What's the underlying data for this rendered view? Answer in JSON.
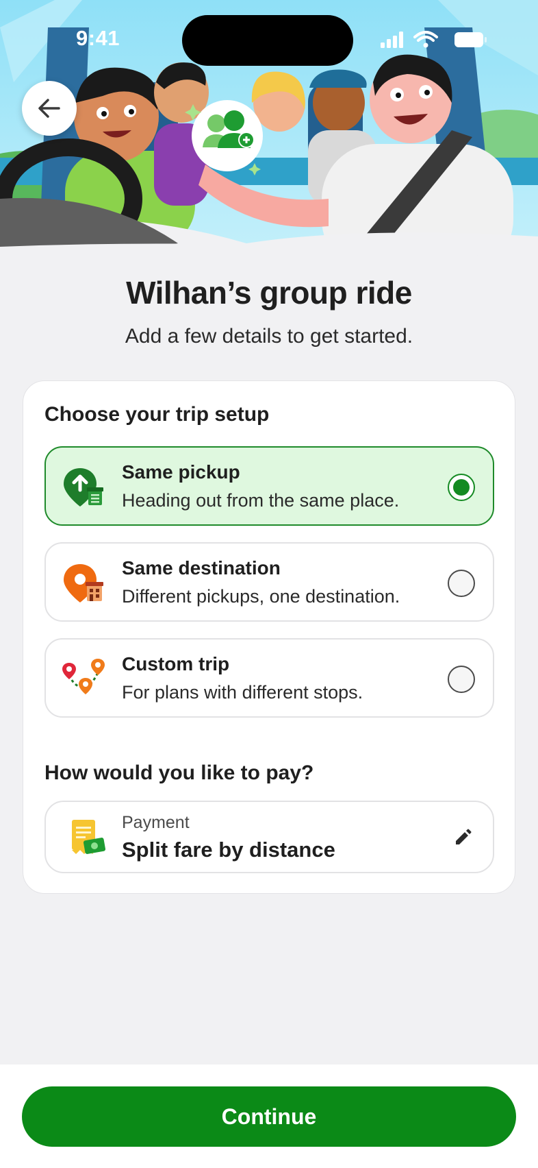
{
  "status_bar": {
    "time": "9:41"
  },
  "header": {
    "title": "Wilhan’s group ride",
    "subtitle": "Add a few details to get started."
  },
  "trip_setup": {
    "heading": "Choose your trip setup",
    "options": [
      {
        "label": "Same pickup",
        "description": "Heading out from the same place.",
        "selected": true,
        "icon": "pickup-pin-icon"
      },
      {
        "label": "Same destination",
        "description": "Different pickups, one destination.",
        "selected": false,
        "icon": "destination-pin-icon"
      },
      {
        "label": "Custom trip",
        "description": "For plans with different stops.",
        "selected": false,
        "icon": "custom-route-icon"
      }
    ]
  },
  "payment": {
    "heading": "How would you like to pay?",
    "label": "Payment",
    "value": "Split fare by distance",
    "icon": "receipt-cash-icon",
    "edit_icon": "pencil-icon"
  },
  "footer": {
    "continue_label": "Continue"
  },
  "colors": {
    "brand_green": "#0b8a17",
    "selected_bg": "#dff8df",
    "selected_border": "#1e8a2a",
    "page_bg": "#f1f1f3"
  }
}
